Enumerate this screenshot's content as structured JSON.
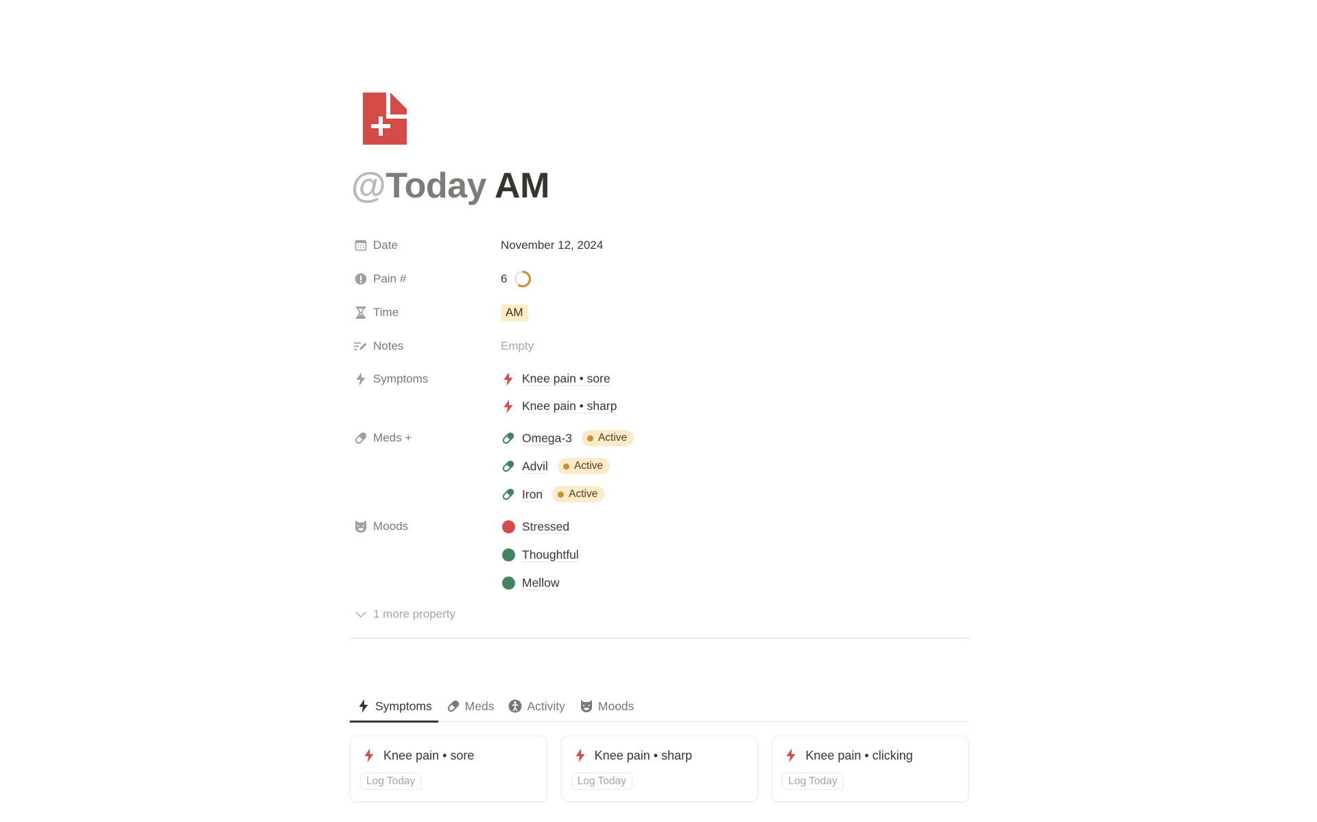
{
  "page": {
    "icon": "document-plus-icon",
    "icon_color": "#d44c47",
    "title": {
      "mention_symbol": "@",
      "mention_text": "Today",
      "rest": " AM"
    }
  },
  "properties": {
    "date": {
      "label": "Date",
      "icon": "calendar-icon",
      "value": "November 12, 2024"
    },
    "pain": {
      "label": "Pain #",
      "icon": "alert-badge-icon",
      "value": "6",
      "ring_fraction": 0.6,
      "ring_color": "#c9912f"
    },
    "time": {
      "label": "Time",
      "icon": "hourglass-icon",
      "value": "AM",
      "tag_bg": "#fdecc8"
    },
    "notes": {
      "label": "Notes",
      "icon": "notes-pen-icon",
      "value": "Empty"
    },
    "symptoms": {
      "label": "Symptoms",
      "icon": "lightning-icon",
      "items": [
        {
          "name": "Knee pain • sore",
          "icon": "lightning-icon"
        },
        {
          "name": "Knee pain • sharp",
          "icon": "lightning-icon"
        }
      ]
    },
    "meds": {
      "label": "Meds +",
      "icon": "pill-icon",
      "items": [
        {
          "name": "Omega-3",
          "icon": "pill-icon",
          "status": "Active"
        },
        {
          "name": "Advil",
          "icon": "pill-icon",
          "status": "Active"
        },
        {
          "name": "Iron",
          "icon": "pill-icon",
          "status": "Active"
        }
      ]
    },
    "moods": {
      "label": "Moods",
      "icon": "mask-icon",
      "items": [
        {
          "name": "Stressed",
          "color": "#d44c47"
        },
        {
          "name": "Thoughtful",
          "color": "#448361"
        },
        {
          "name": "Mellow",
          "color": "#448361"
        }
      ]
    },
    "more": {
      "label": "1 more property",
      "icon": "chevron-down-icon"
    }
  },
  "tabs": [
    {
      "label": "Symptoms",
      "icon": "lightning-icon",
      "active": true
    },
    {
      "label": "Meds",
      "icon": "pill-icon",
      "active": false
    },
    {
      "label": "Activity",
      "icon": "person-walking-icon",
      "active": false
    },
    {
      "label": "Moods",
      "icon": "mask-icon",
      "active": false
    }
  ],
  "cards": [
    {
      "title": "Knee pain • sore",
      "icon": "lightning-icon",
      "button": "Log Today"
    },
    {
      "title": "Knee pain • sharp",
      "icon": "lightning-icon",
      "button": "Log Today"
    },
    {
      "title": "Knee pain • clicking",
      "icon": "lightning-icon",
      "button": "Log Today"
    }
  ],
  "colors": {
    "red": "#d44c47",
    "green": "#448361",
    "orange": "#c9912f",
    "text": "#37352f",
    "muted": "#787774"
  }
}
